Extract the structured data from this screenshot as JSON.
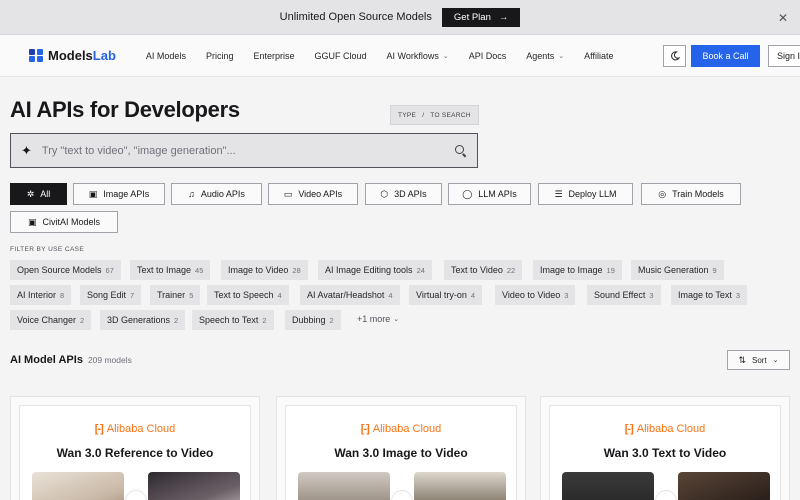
{
  "announcement": {
    "text": "Unlimited Open Source Models",
    "cta_label": "Get Plan",
    "cta_icon": "arrow-right-icon",
    "close_icon": "close-icon"
  },
  "nav": {
    "logo_main": "Models",
    "logo_accent": "Lab",
    "items": [
      {
        "label": "AI Models",
        "dropdown": false
      },
      {
        "label": "Pricing",
        "dropdown": false
      },
      {
        "label": "Enterprise",
        "dropdown": false
      },
      {
        "label": "GGUF Cloud",
        "dropdown": false
      },
      {
        "label": "AI Workflows",
        "dropdown": true
      },
      {
        "label": "API Docs",
        "dropdown": false
      },
      {
        "label": "Agents",
        "dropdown": true
      },
      {
        "label": "Affiliate",
        "dropdown": false
      }
    ],
    "theme_icon": "moon-icon",
    "book_call_label": "Book a Call",
    "sign_in_label": "Sign In",
    "accent_color": "#2563eb"
  },
  "hero": {
    "title": "AI APIs for Developers",
    "kbd_key": "TYPE",
    "kbd_sep": "/",
    "kbd_action": "TO SEARCH",
    "search_placeholder": "Try \"text to video\", \"image generation\"...",
    "search_value": ""
  },
  "categories": [
    {
      "label": "All",
      "icon": "sparkles-icon",
      "active": true
    },
    {
      "label": "Image APIs",
      "icon": "image-icon",
      "active": false
    },
    {
      "label": "Audio APIs",
      "icon": "music-icon",
      "active": false
    },
    {
      "label": "Video APIs",
      "icon": "video-icon",
      "active": false
    },
    {
      "label": "3D APIs",
      "icon": "cube-icon",
      "active": false
    },
    {
      "label": "LLM APIs",
      "icon": "chat-icon",
      "active": false
    },
    {
      "label": "Deploy LLM",
      "icon": "server-icon",
      "active": false
    },
    {
      "label": "Train Models",
      "icon": "train-icon",
      "active": false
    },
    {
      "label": "CivitAI Models",
      "icon": "image-icon",
      "active": false
    }
  ],
  "filters": {
    "label": "FILTER BY USE CASE",
    "chips": [
      {
        "label": "Open Source Models",
        "count": "67"
      },
      {
        "label": "Text to Image",
        "count": "45"
      },
      {
        "label": "Image to Video",
        "count": "28"
      },
      {
        "label": "AI Image Editing tools",
        "count": "24"
      },
      {
        "label": "Text to Video",
        "count": "22"
      },
      {
        "label": "Image to Image",
        "count": "19"
      },
      {
        "label": "Music Generation",
        "count": "9"
      },
      {
        "label": "AI Interior",
        "count": "8"
      },
      {
        "label": "Song Edit",
        "count": "7"
      },
      {
        "label": "Trainer",
        "count": "5"
      },
      {
        "label": "Text to Speech",
        "count": "4"
      },
      {
        "label": "AI Avatar/Headshot",
        "count": "4"
      },
      {
        "label": "Virtual try-on",
        "count": "4"
      },
      {
        "label": "Video to Video",
        "count": "3"
      },
      {
        "label": "Sound Effect",
        "count": "3"
      },
      {
        "label": "Image to Text",
        "count": "3"
      },
      {
        "label": "Voice Changer",
        "count": "2"
      },
      {
        "label": "3D Generations",
        "count": "2"
      },
      {
        "label": "Speech to Text",
        "count": "2"
      },
      {
        "label": "Dubbing",
        "count": "2"
      }
    ],
    "more_label": "+1 more"
  },
  "models_section": {
    "title": "AI Model APIs",
    "count_label": "209 models",
    "sort_label": "Sort",
    "sort_icon": "sort-icon"
  },
  "cards": [
    {
      "brand": "Alibaba Cloud",
      "brand_mark": "[-]",
      "title": "Wan 3.0 Reference to Video",
      "brand_color": "#f97316"
    },
    {
      "brand": "Alibaba Cloud",
      "brand_mark": "[-]",
      "title": "Wan 3.0 Image to Video",
      "brand_color": "#f97316"
    },
    {
      "brand": "Alibaba Cloud",
      "brand_mark": "[-]",
      "title": "Wan 3.0 Text to Video",
      "brand_color": "#f97316"
    }
  ]
}
